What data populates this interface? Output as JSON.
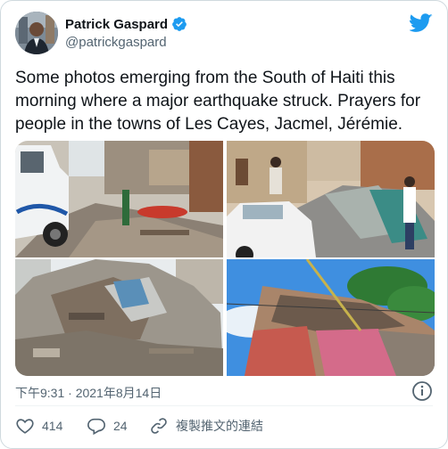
{
  "author": {
    "display_name": "Patrick Gaspard",
    "handle": "@patrickgaspard",
    "verified": true
  },
  "tweet": {
    "text": "Some photos emerging from the South of Haiti this morning where a major earthquake struck. Prayers for people in the towns of Les Cayes, Jacmel, Jérémie.",
    "timestamp": "下午9:31 · 2021年8月14日"
  },
  "actions": {
    "likes": "414",
    "replies": "24",
    "copy_link_label": "複製推文的連結"
  },
  "colors": {
    "brand": "#1d9bf0",
    "text": "#0f1419",
    "muted": "#536471"
  },
  "icons": {
    "logo": "twitter-bird-icon",
    "verified": "verified-badge-icon",
    "info": "info-icon",
    "like": "heart-icon",
    "reply": "reply-icon",
    "link": "link-icon"
  }
}
